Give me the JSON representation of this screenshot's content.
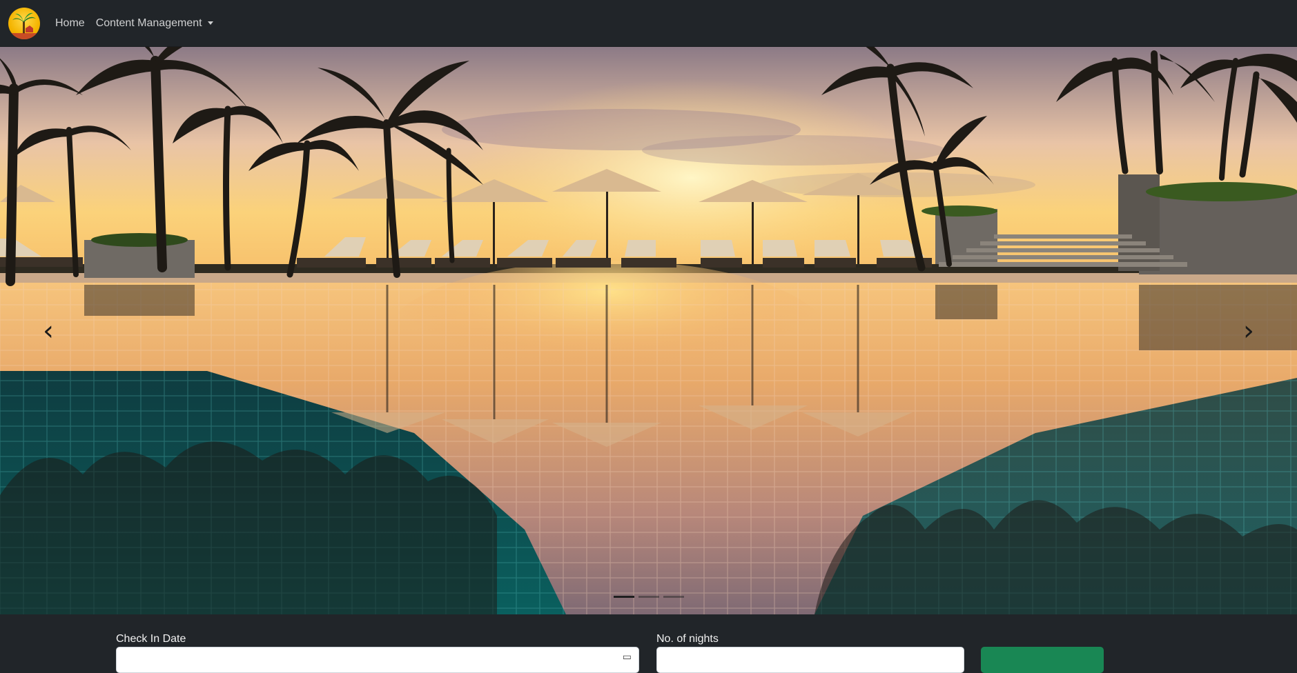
{
  "navbar": {
    "logo_icon": "palm-tree-logo-icon",
    "links": [
      {
        "label": "Home"
      },
      {
        "label": "Content Management",
        "has_dropdown": true
      }
    ]
  },
  "carousel": {
    "slide_count": 3,
    "active_slide": 1,
    "prev_icon": "chevron-left-icon",
    "next_icon": "chevron-right-icon"
  },
  "booking": {
    "checkin_label": "Check In Date",
    "nights_label": "No. of nights",
    "calendar_icon": "calendar-icon",
    "submit_color": "#198754"
  },
  "colors": {
    "navbar_bg": "#212529",
    "button_green": "#198754",
    "logo_yellow": "#f4b400"
  }
}
